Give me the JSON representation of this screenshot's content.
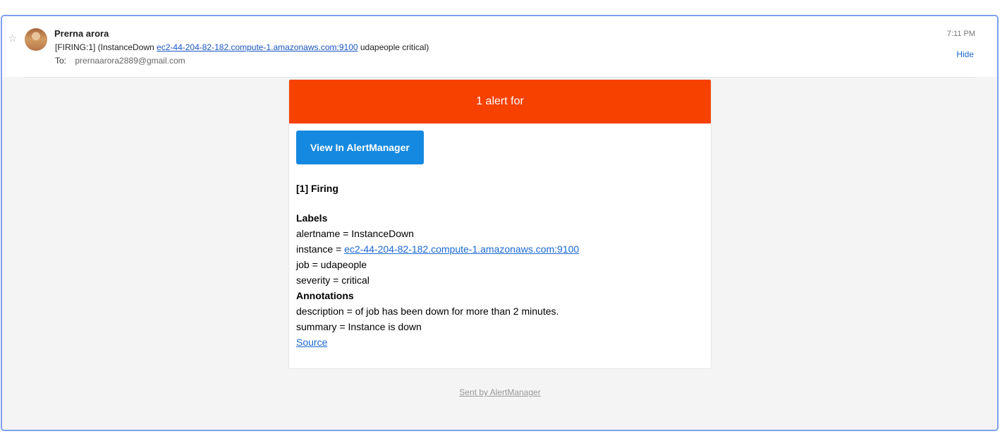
{
  "header": {
    "sender_name": "Prerna arora",
    "subject_prefix": "[FIRING:1]  (InstanceDown ",
    "subject_link": "ec2-44-204-82-182.compute-1.amazonaws.com:9100",
    "subject_suffix": " udapeople critical)",
    "to_label": "To:",
    "to_address": "prernaarora2889@gmail.com",
    "time": "7:11 PM",
    "hide_label": "Hide",
    "star_icon": "star-icon",
    "avatar_icon": "avatar"
  },
  "alert": {
    "banner_text": "1 alert for",
    "button_label": "View In AlertManager",
    "button_color": "#1589e0",
    "banner_color": "#f74100",
    "firing_heading": "[1] Firing",
    "labels_heading": "Labels",
    "alertname_line": "alertname = InstanceDown",
    "instance_prefix": "instance = ",
    "instance_link": "ec2-44-204-82-182.compute-1.amazonaws.com:9100",
    "job_line": "job = udapeople",
    "severity_line": "severity = critical",
    "annotations_heading": "Annotations",
    "description_line": "description = of job has been down for more than 2 minutes.",
    "summary_line": "summary = Instance is down",
    "source_link": "Source"
  },
  "footer": {
    "sent_by": "Sent by AlertManager"
  }
}
